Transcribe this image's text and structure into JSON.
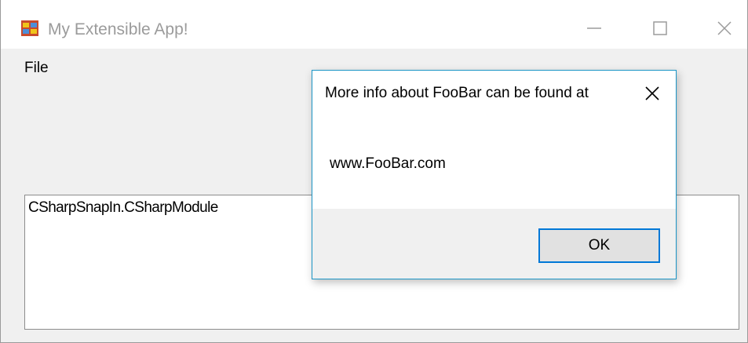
{
  "window": {
    "title": "My Extensible App!",
    "icon": "windows-forms-app-icon",
    "controls": [
      "minimize-icon",
      "maximize-icon",
      "close-icon"
    ]
  },
  "menu": {
    "items": [
      {
        "label": "File"
      }
    ]
  },
  "listbox": {
    "items": [
      "CSharpSnapIn.CSharpModule"
    ]
  },
  "dialog": {
    "title": "More info about FooBar can be found at",
    "message": "www.FooBar.com",
    "ok_label": "OK",
    "accent_color": "#1b95c6"
  }
}
